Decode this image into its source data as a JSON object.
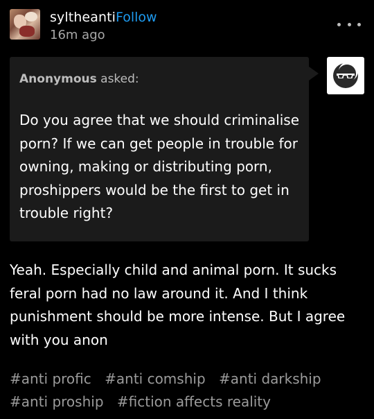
{
  "post": {
    "username": "syltheanti",
    "follow_label": "Follow",
    "timestamp": "16m ago",
    "avatar_icon": "user-avatar-icon",
    "more_icon": "more-options-icon"
  },
  "ask": {
    "asker_name": "Anonymous",
    "asked_label": " asked:",
    "question": "Do you agree that we should criminalise porn? If we can get people in trouble for owning, making or distributing porn, proshippers would be the first to get in trouble right?",
    "asker_avatar_icon": "sunglasses-moon-icon"
  },
  "answer": "Yeah. Especially child and animal porn. It sucks feral porn had no law around it. And I think punishment should be more intense. But I agree with you anon",
  "tags": [
    "#anti proﬁc",
    "#anti comship",
    "#anti darkship",
    "#anti proship",
    "#ﬁction affects reality"
  ],
  "colors": {
    "background": "#000000",
    "ask_box": "#1b1b1b",
    "follow": "#1e9bf0",
    "tag": "#9b9b9b",
    "secondary_text": "#a8a8a8"
  }
}
